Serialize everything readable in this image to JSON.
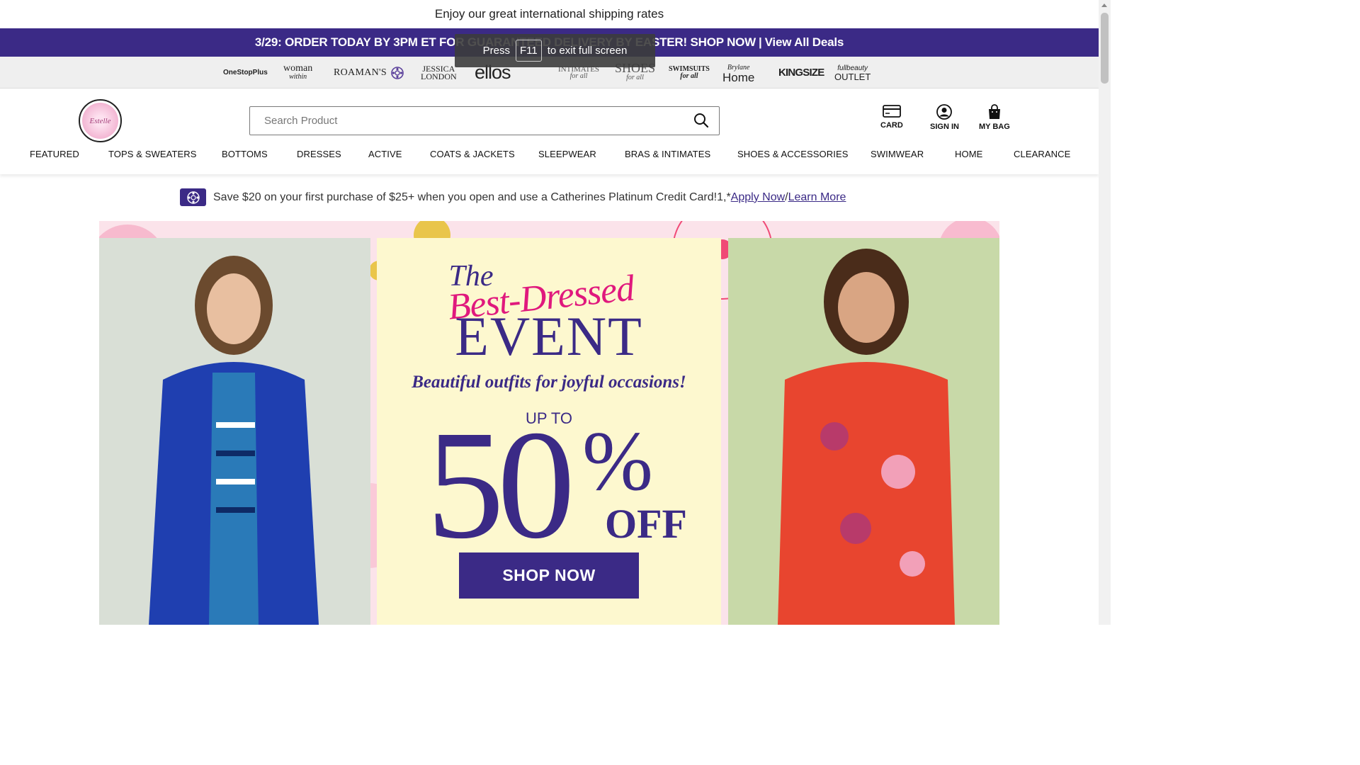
{
  "info_bar": {
    "text": "Enjoy our great international shipping rates"
  },
  "promo_bar": {
    "text": "3/29: ORDER TODAY BY 3PM ET FOR GUARANTEED DELIVERY BY EASTER! SHOP NOW",
    "separator": "|",
    "link": "View All Deals"
  },
  "fullscreen_toast": {
    "press": "Press",
    "key": "F11",
    "rest": "to exit full screen"
  },
  "brands": [
    {
      "name": "OneStopPlus"
    },
    {
      "name": "woman",
      "sub": "within"
    },
    {
      "name": "ROAMAN'S"
    },
    {
      "name": "catherines-icon"
    },
    {
      "name": "JESSICA",
      "sub": "LONDON"
    },
    {
      "name": "ellos"
    },
    {
      "name": "INTIMATES",
      "sub": "for all"
    },
    {
      "name": "SHOES",
      "sub": "for all"
    },
    {
      "name": "SWIMSUITS",
      "sub": "for all"
    },
    {
      "name": "Brylane",
      "sub": "Home"
    },
    {
      "name": "KINGSIZE"
    },
    {
      "name": "fullbeauty",
      "sub": "OUTLET"
    }
  ],
  "header": {
    "logo_text": "Estelle",
    "search": {
      "placeholder": "Search Product",
      "value": ""
    },
    "utilities": {
      "card": "CARD",
      "sign_in": "SIGN IN",
      "bag": "MY BAG"
    },
    "nav": [
      "FEATURED",
      "TOPS & SWEATERS",
      "BOTTOMS",
      "DRESSES",
      "ACTIVE",
      "COATS & JACKETS",
      "SLEEPWEAR",
      "BRAS & INTIMATES",
      "SHOES & ACCESSORIES",
      "SWIMWEAR",
      "HOME",
      "CLEARANCE"
    ]
  },
  "credit_notice": {
    "text": "Save $20 on your first purchase of $25+ when you open and use a Catherines Platinum Credit Card!1,*",
    "apply": "Apply Now",
    "slash": "/",
    "learn": "Learn More"
  },
  "hero": {
    "the": "The",
    "script": "Best-Dressed",
    "event": "EVENT",
    "subtitle": "Beautiful outfits for joyful occasions!",
    "up_to": "UP TO",
    "amount": "50",
    "percent": "%",
    "off": "OFF",
    "cta": "SHOP NOW"
  },
  "colors": {
    "brand_purple": "#3b2a86",
    "accent_pink": "#e0197d",
    "hero_background": "#fbe3ea",
    "panel_cream": "#fdf8cf"
  }
}
